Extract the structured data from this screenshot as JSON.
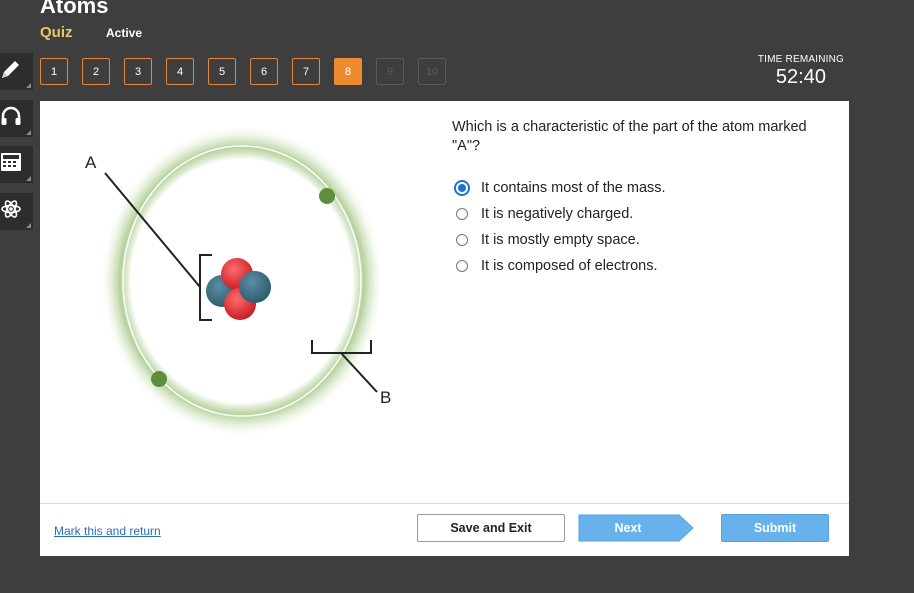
{
  "header": {
    "title": "Atoms",
    "quiz_label": "Quiz",
    "status": "Active"
  },
  "question_nav": [
    {
      "label": "1",
      "state": "normal"
    },
    {
      "label": "2",
      "state": "normal"
    },
    {
      "label": "3",
      "state": "normal"
    },
    {
      "label": "4",
      "state": "normal"
    },
    {
      "label": "5",
      "state": "normal"
    },
    {
      "label": "6",
      "state": "normal"
    },
    {
      "label": "7",
      "state": "normal"
    },
    {
      "label": "8",
      "state": "current"
    },
    {
      "label": "9",
      "state": "disabled"
    },
    {
      "label": "10",
      "state": "disabled"
    }
  ],
  "timer": {
    "label": "TIME REMAINING",
    "value": "52:40"
  },
  "tools": [
    "pencil-icon",
    "headphones-icon",
    "calculator-icon",
    "atom-icon"
  ],
  "diagram": {
    "label_a": "A",
    "label_b": "B"
  },
  "question": {
    "text": "Which is a characteristic of the part of the atom marked \"A\"?",
    "options": [
      {
        "text": "It contains most of the mass.",
        "selected": true
      },
      {
        "text": "It is negatively charged.",
        "selected": false
      },
      {
        "text": "It is mostly empty space.",
        "selected": false
      },
      {
        "text": "It is composed of electrons.",
        "selected": false
      }
    ]
  },
  "footer": {
    "mark_link": "Mark this and return",
    "save_label": "Save and Exit",
    "next_label": "Next",
    "submit_label": "Submit"
  },
  "colors": {
    "background": "#3e3e3e",
    "accent_orange": "#f08a2e",
    "quiz_gold": "#e8c76a",
    "primary_blue": "#67b1ec",
    "radio_blue": "#1f72c9"
  }
}
